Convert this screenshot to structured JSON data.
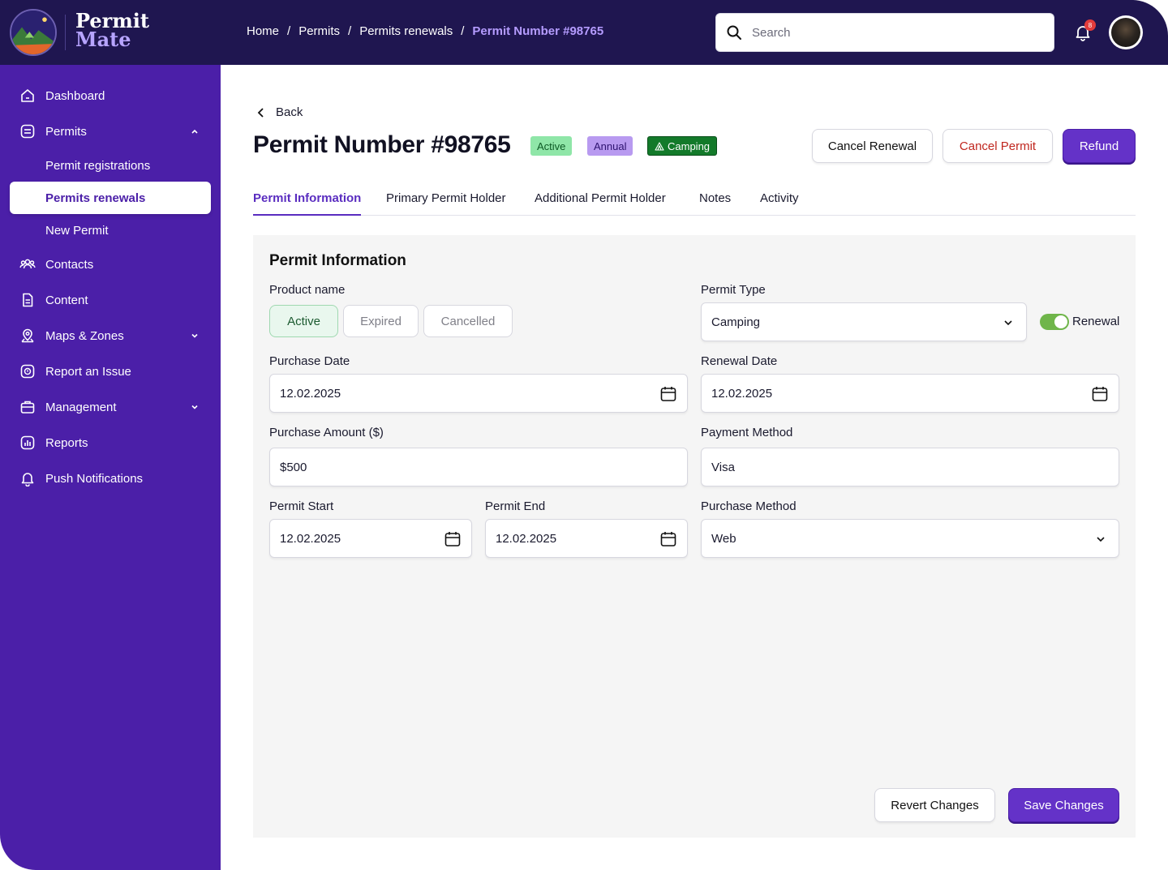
{
  "brand": {
    "line1": "Permit",
    "line2": "Mate"
  },
  "breadcrumb": {
    "home": "Home",
    "permits": "Permits",
    "renewals": "Permits renewals",
    "current": "Permit Number #98765",
    "sep": "/"
  },
  "search": {
    "placeholder": "Search",
    "value": ""
  },
  "notifications": {
    "count": "8"
  },
  "sidebar": {
    "dashboard": "Dashboard",
    "permits": "Permits",
    "permit_registrations": "Permit registrations",
    "permits_renewals": "Permits renewals",
    "new_permit": "New Permit",
    "contacts": "Contacts",
    "content": "Content",
    "maps_zones": "Maps & Zones",
    "report_issue": "Report an Issue",
    "management": "Management",
    "reports": "Reports",
    "push_notifications": "Push Notifications"
  },
  "header": {
    "back": "Back",
    "title": "Permit Number #98765",
    "badges": {
      "active": "Active",
      "annual": "Annual",
      "camping": "Camping"
    },
    "actions": {
      "cancel_renewal": "Cancel Renewal",
      "cancel_permit": "Cancel Permit",
      "refund": "Refund"
    }
  },
  "tabs": {
    "permit_information": "Permit Information",
    "primary_holder": "Primary Permit Holder",
    "additional_holder": "Additional Permit Holder",
    "notes": "Notes",
    "activity": "Activity"
  },
  "form": {
    "title": "Permit Information",
    "product_name_label": "Product name",
    "status_options": {
      "active": "Active",
      "expired": "Expired",
      "cancelled": "Cancelled"
    },
    "permit_type_label": "Permit Type",
    "permit_type_value": "Camping",
    "renewal_toggle_label": "Renewal",
    "purchase_date_label": "Purchase Date",
    "purchase_date_value": "12.02.2025",
    "renewal_date_label": "Renewal Date",
    "renewal_date_value": "12.02.2025",
    "purchase_amount_label": "Purchase Amount ($)",
    "purchase_amount_value": "$500",
    "payment_method_label": "Payment Method",
    "payment_method_value": "Visa",
    "permit_start_label": "Permit Start",
    "permit_start_value": "12.02.2025",
    "permit_end_label": "Permit End",
    "permit_end_value": "12.02.2025",
    "purchase_method_label": "Purchase Method",
    "purchase_method_value": "Web",
    "revert_label": "Revert Changes",
    "save_label": "Save Changes"
  },
  "colors": {
    "topbar": "#1f1650",
    "sidebar": "#4b1fa8",
    "accent": "#6432c8",
    "active_green": "#8fe6a8"
  }
}
